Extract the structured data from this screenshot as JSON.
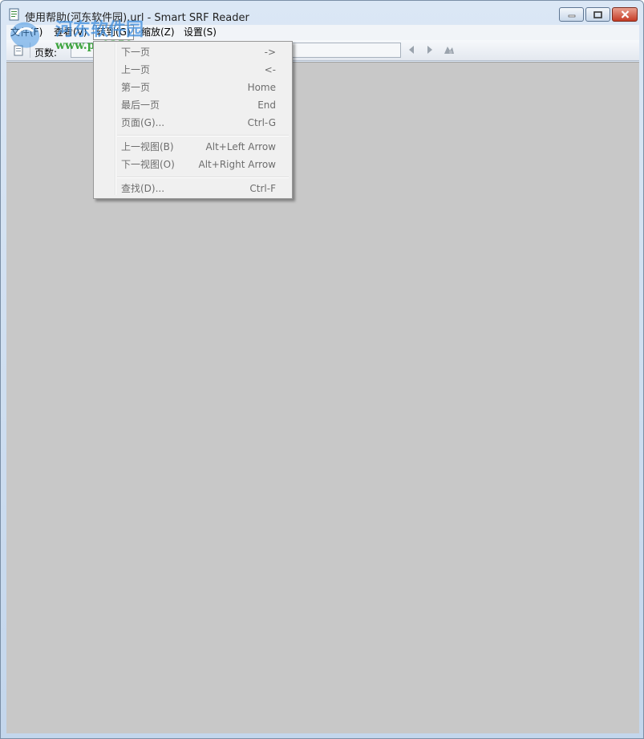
{
  "window": {
    "title": "使用帮助(河东软件园).url - Smart SRF Reader"
  },
  "watermark": {
    "top_text": "河东软件园",
    "bottom_text": "www.pc0359.cn"
  },
  "menubar": {
    "items": [
      {
        "label": "文件(F)"
      },
      {
        "label": "查看(V)"
      },
      {
        "label": "转到(G)"
      },
      {
        "label": "缩放(Z)"
      },
      {
        "label": "设置(S)"
      }
    ]
  },
  "toolbar": {
    "page_label": "页数:"
  },
  "goto_menu": {
    "items": [
      {
        "label": "下一页",
        "shortcut": "->"
      },
      {
        "label": "上一页",
        "shortcut": "<-"
      },
      {
        "label": "第一页",
        "shortcut": "Home"
      },
      {
        "label": "最后一页",
        "shortcut": "End"
      },
      {
        "label": "页面(G)...",
        "shortcut": "Ctrl-G"
      },
      {
        "label": "上一视图(B)",
        "shortcut": "Alt+Left Arrow"
      },
      {
        "label": "下一视图(O)",
        "shortcut": "Alt+Right Arrow"
      },
      {
        "label": "查找(D)...",
        "shortcut": "Ctrl-F"
      }
    ]
  },
  "colors": {
    "client_background": "#c8c8c8",
    "menu_background": "#f0f0f0",
    "disabled_text": "#6d6d6d"
  }
}
